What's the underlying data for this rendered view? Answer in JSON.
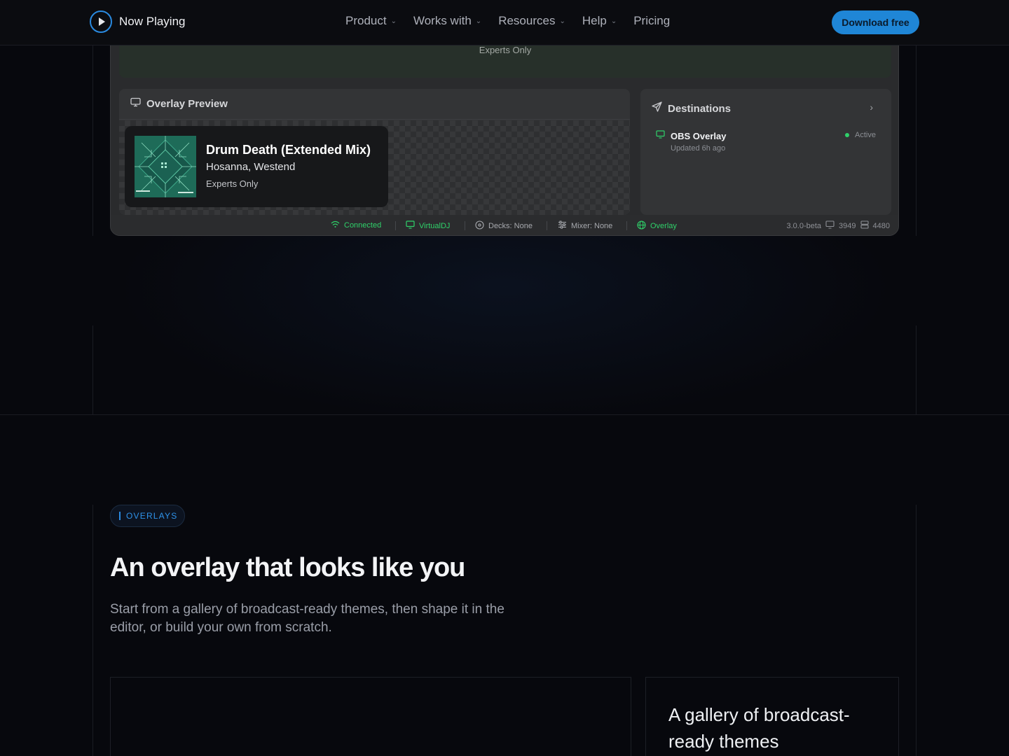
{
  "nav": {
    "brand": "Now Playing",
    "menu": [
      {
        "label": "Product",
        "has_dropdown": true
      },
      {
        "label": "Works with",
        "has_dropdown": true
      },
      {
        "label": "Resources",
        "has_dropdown": true
      },
      {
        "label": "Help",
        "has_dropdown": true
      },
      {
        "label": "Pricing",
        "has_dropdown": false
      }
    ],
    "cta": "Download free"
  },
  "app": {
    "top_panel_text": "Experts Only",
    "overlay_preview": {
      "title": "Overlay Preview",
      "track_title": "Drum Death (Extended Mix)",
      "artist": "Hosanna, Westend",
      "album": "Experts Only"
    },
    "destinations": {
      "title": "Destinations",
      "item_name": "OBS Overlay",
      "item_updated": "Updated 6h ago",
      "item_status": "Active"
    },
    "status_bar": {
      "connected": "Connected",
      "source": "VirtualDJ",
      "decks": "Decks: None",
      "mixer": "Mixer: None",
      "overlay": "Overlay",
      "version": "3.0.0-beta",
      "port_a": "3949",
      "port_b": "4480"
    }
  },
  "section": {
    "tag": "OVERLAYS",
    "heading": "An overlay that looks like you",
    "lead": "Start from a gallery of broadcast-ready themes, then shape it in the editor, or build your own from scratch.",
    "card_heading": "A gallery of broadcast-ready themes"
  },
  "colors": {
    "accent": "#1f86d6",
    "status_green": "#2fd16a",
    "background": "#07080d"
  }
}
